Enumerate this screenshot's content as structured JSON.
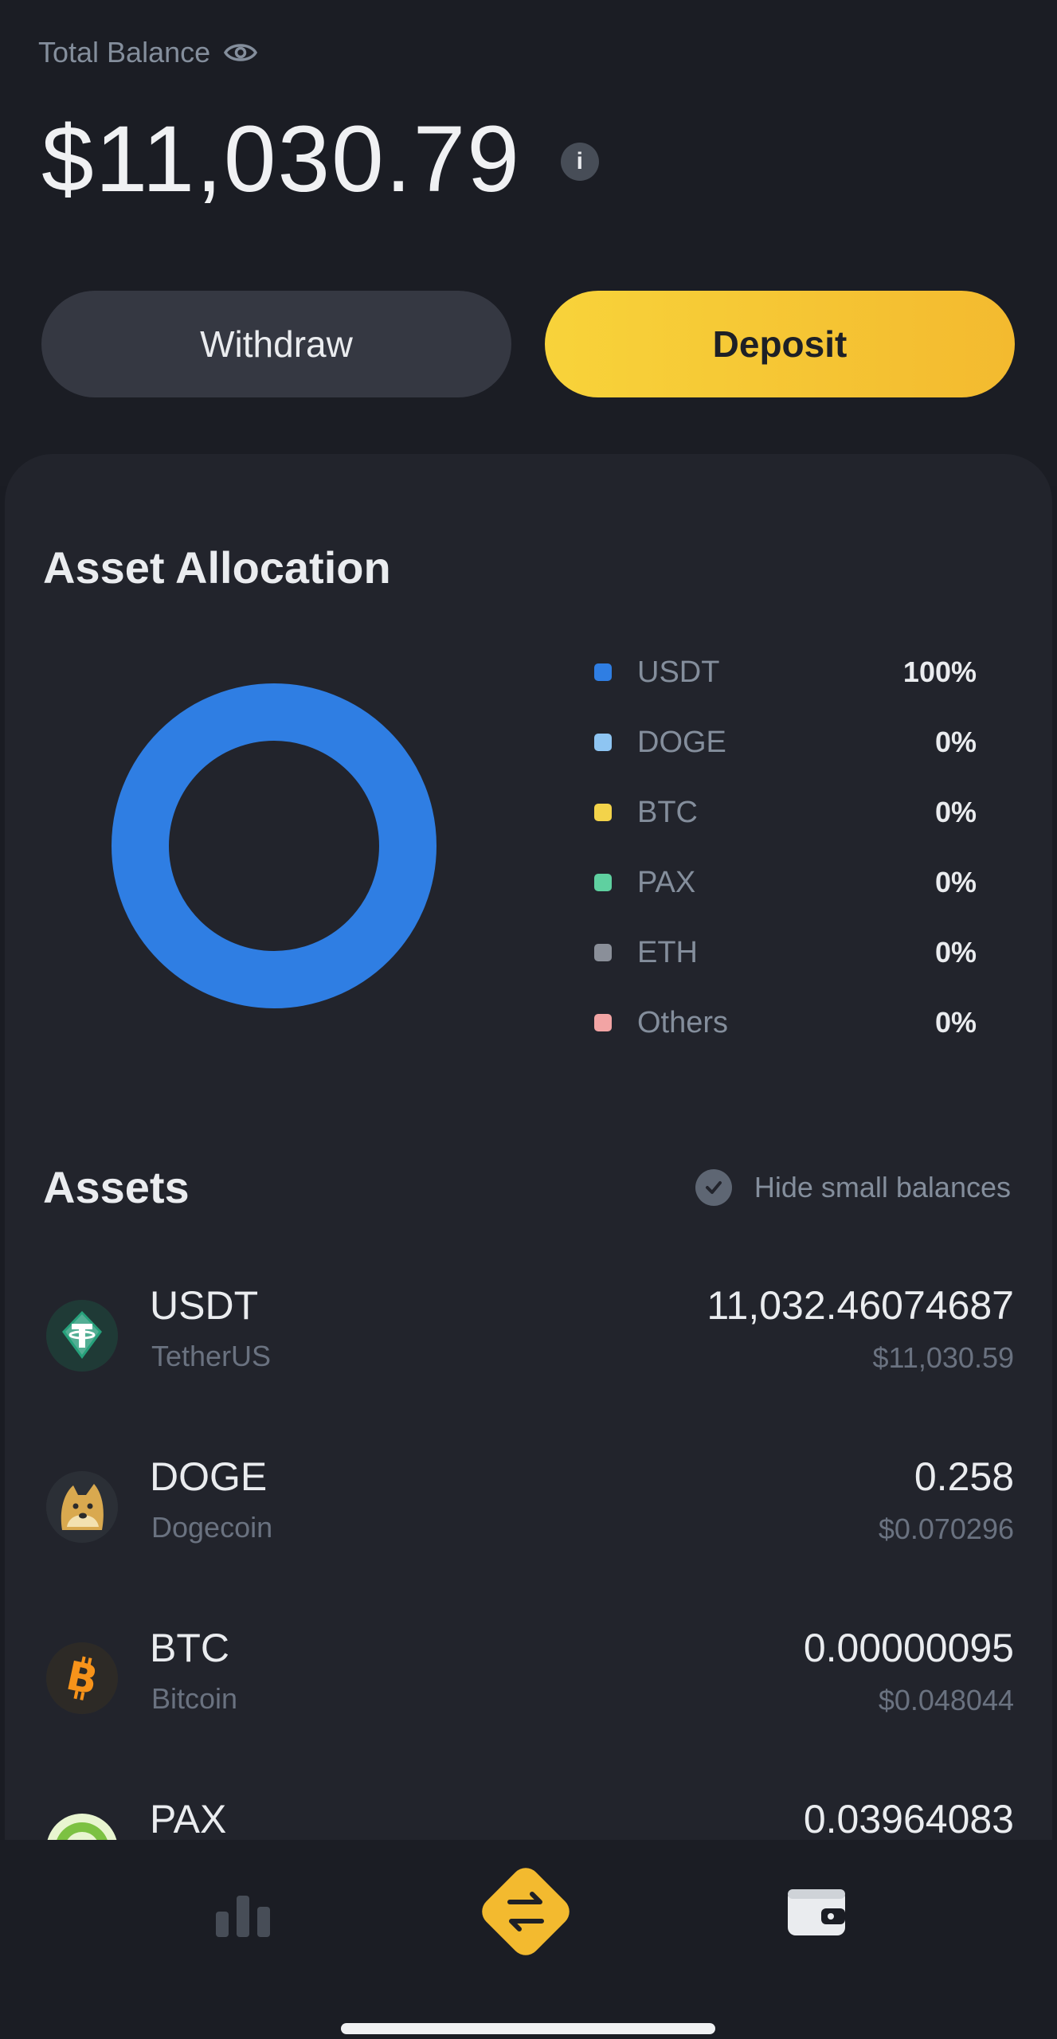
{
  "header": {
    "balance_label": "Total Balance",
    "balance_amount": "$11,030.79",
    "info_icon": "i",
    "withdraw_label": "Withdraw",
    "deposit_label": "Deposit"
  },
  "allocation": {
    "title": "Asset Allocation",
    "legend": [
      {
        "name": "USDT",
        "percent": "100%",
        "color": "#2f7ee3"
      },
      {
        "name": "DOGE",
        "percent": "0%",
        "color": "#8ec5f2"
      },
      {
        "name": "BTC",
        "percent": "0%",
        "color": "#f3d34a"
      },
      {
        "name": "PAX",
        "percent": "0%",
        "color": "#5fd0a0"
      },
      {
        "name": "ETH",
        "percent": "0%",
        "color": "#8a8f99"
      },
      {
        "name": "Others",
        "percent": "0%",
        "color": "#f2a4a4"
      }
    ]
  },
  "chart_data": {
    "type": "pie",
    "categories": [
      "USDT",
      "DOGE",
      "BTC",
      "PAX",
      "ETH",
      "Others"
    ],
    "values": [
      100,
      0,
      0,
      0,
      0,
      0
    ],
    "title": "Asset Allocation"
  },
  "assets": {
    "title": "Assets",
    "hide_small_label": "Hide small balances",
    "rows": [
      {
        "symbol": "USDT",
        "name": "TetherUS",
        "amount": "11,032.46074687",
        "value": "$11,030.59",
        "icon": "tether-icon"
      },
      {
        "symbol": "DOGE",
        "name": "Dogecoin",
        "amount": "0.258",
        "value": "$0.070296",
        "icon": "dogecoin-icon"
      },
      {
        "symbol": "BTC",
        "name": "Bitcoin",
        "amount": "0.00000095",
        "value": "$0.048044",
        "icon": "bitcoin-icon"
      },
      {
        "symbol": "PAX",
        "name": "",
        "amount": "0.03964083",
        "value": "",
        "icon": "pax-icon"
      }
    ]
  },
  "nav": {
    "items": [
      "markets-icon",
      "trade-icon",
      "wallet-icon"
    ]
  },
  "colors": {
    "accent": "#f3ba2f",
    "background": "#1b1d24",
    "card": "#22242c",
    "muted_text": "#848e9c"
  }
}
